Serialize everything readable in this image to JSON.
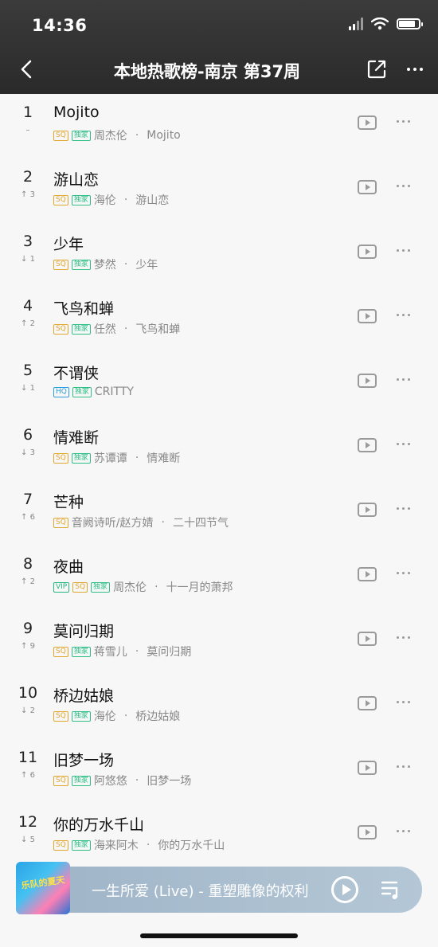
{
  "status_bar": {
    "time": "14:36"
  },
  "header": {
    "title": "本地热歌榜-南京 第37周"
  },
  "colors": {
    "header_bg": "#2f2f2f",
    "sq": "#e0a630",
    "hq": "#2b9de0",
    "exclusive": "#2dbf86",
    "player_bg": "#a9bdcf"
  },
  "songs": [
    {
      "rank": "1",
      "change": "–",
      "title": "Mojito",
      "tags": [
        "SQ",
        "独家"
      ],
      "artist": "周杰伦",
      "album": "Mojito"
    },
    {
      "rank": "2",
      "change": "↑ 3",
      "title": "游山恋",
      "tags": [
        "SQ",
        "独家"
      ],
      "artist": "海伦",
      "album": "游山恋"
    },
    {
      "rank": "3",
      "change": "↓ 1",
      "title": "少年",
      "tags": [
        "SQ",
        "独家"
      ],
      "artist": "梦然",
      "album": "少年"
    },
    {
      "rank": "4",
      "change": "↑ 2",
      "title": "飞鸟和蝉",
      "tags": [
        "SQ",
        "独家"
      ],
      "artist": "任然",
      "album": "飞鸟和蝉"
    },
    {
      "rank": "5",
      "change": "↓ 1",
      "title": "不谓侠",
      "tags": [
        "HQ",
        "独家"
      ],
      "artist": "CRITTY",
      "album": ""
    },
    {
      "rank": "6",
      "change": "↓ 3",
      "title": "情难断",
      "tags": [
        "SQ",
        "独家"
      ],
      "artist": "苏谭谭",
      "album": "情难断"
    },
    {
      "rank": "7",
      "change": "↑ 6",
      "title": "芒种",
      "tags": [
        "SQ"
      ],
      "artist": "音阙诗听/赵方婧",
      "album": "二十四节气"
    },
    {
      "rank": "8",
      "change": "↑ 2",
      "title": "夜曲",
      "tags": [
        "VIP",
        "SQ",
        "独家"
      ],
      "artist": "周杰伦",
      "album": "十一月的萧邦"
    },
    {
      "rank": "9",
      "change": "↑ 9",
      "title": "莫问归期",
      "tags": [
        "SQ",
        "独家"
      ],
      "artist": "蒋雪儿",
      "album": "莫问归期"
    },
    {
      "rank": "10",
      "change": "↓ 2",
      "title": "桥边姑娘",
      "tags": [
        "SQ",
        "独家"
      ],
      "artist": "海伦",
      "album": "桥边姑娘"
    },
    {
      "rank": "11",
      "change": "↑ 6",
      "title": "旧梦一场",
      "tags": [
        "SQ",
        "独家"
      ],
      "artist": "阿悠悠",
      "album": "旧梦一场"
    },
    {
      "rank": "12",
      "change": "↓ 5",
      "title": "你的万水千山",
      "tags": [
        "SQ",
        "独家"
      ],
      "artist": "海来阿木",
      "album": "你的万水千山"
    }
  ],
  "player": {
    "now_playing": "一生所爱 (Live) - 重塑雕像的权利",
    "album_art_text": "乐队的夏天"
  }
}
